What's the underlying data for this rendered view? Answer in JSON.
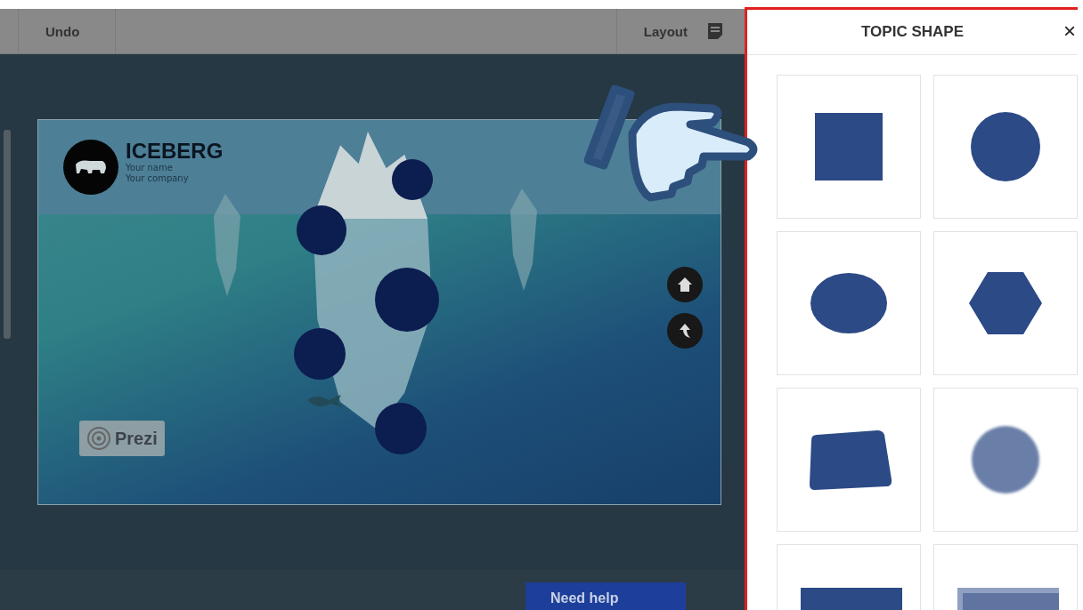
{
  "toolbar": {
    "undo": "Undo",
    "layout": "Layout"
  },
  "slide": {
    "title": "ICEBERG",
    "subtitle_lines": [
      "Your name",
      "Your company"
    ],
    "badge": "Prezi"
  },
  "help_button": "Need help",
  "panel": {
    "title": "TOPIC SHAPE",
    "close": "×",
    "shapes": [
      {
        "kind": "square"
      },
      {
        "kind": "circle"
      },
      {
        "kind": "ellipse"
      },
      {
        "kind": "hexagon"
      },
      {
        "kind": "quad"
      },
      {
        "kind": "soft-circle"
      },
      {
        "kind": "rect"
      },
      {
        "kind": "shadow-rect"
      }
    ]
  }
}
